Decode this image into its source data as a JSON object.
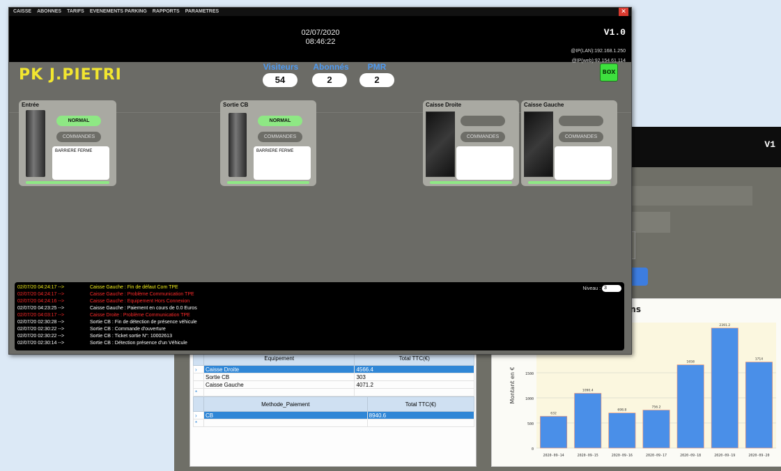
{
  "back_window": {
    "version": "V1",
    "table_equipment": {
      "headers": [
        "Equipement",
        "Total TTC(€)"
      ],
      "rows": [
        {
          "name": "Caisse Droite",
          "total": "4566.4",
          "selected": true
        },
        {
          "name": "Sortie CB",
          "total": "303",
          "selected": false
        },
        {
          "name": "Caisse Gauche",
          "total": "4071.2",
          "selected": false
        }
      ]
    },
    "table_payment": {
      "headers": [
        "Methode_Paiement",
        "Total TTC(€)"
      ],
      "rows": [
        {
          "name": "CB",
          "total": "8940.6",
          "selected": true
        }
      ]
    },
    "chart_title_visible": "actions"
  },
  "chart_data": {
    "type": "bar",
    "title": "actions",
    "ylabel": "Montant en €",
    "xlabel": "",
    "categories": [
      "2020-09-14",
      "2020-09-15",
      "2020-09-16",
      "2020-09-17",
      "2020-09-18",
      "2020-09-19",
      "2020-09-20"
    ],
    "values": [
      632,
      1090.4,
      698.8,
      756.2,
      1658,
      2391.2,
      1714
    ],
    "value_labels": [
      "632",
      "1090.4",
      "698.8",
      "756.2",
      "1658",
      "2391.2",
      "1714"
    ],
    "yticks": [
      0,
      500,
      1000,
      1500
    ],
    "ylim": [
      0,
      2500
    ],
    "grid": true,
    "bar_color": "#4a8fe8"
  },
  "front_window": {
    "menu": [
      "CAISSE",
      "ABONNES",
      "TARIFS",
      "EVENEMENTS PARKING",
      "RAPPORTS",
      "PARAMETRES"
    ],
    "date": "02/07/2020",
    "time": "08:46:22",
    "version": "V1.0",
    "ip_lan": "@IP(LAN):192.168.1.250",
    "ip_web": "@IP(web):92.154.61.114",
    "site_name": "PK J.PIETRI",
    "counters": [
      {
        "label": "Visiteurs",
        "value": "54"
      },
      {
        "label": "Abonnés",
        "value": "2"
      },
      {
        "label": "PMR",
        "value": "2"
      }
    ],
    "box_logo": "BOX",
    "equipment": [
      {
        "title": "Entrée",
        "status": "NORMAL",
        "commands": "COMMANDES",
        "info": "BARRIERE FERME"
      },
      {
        "title": "Sortie CB",
        "status": "NORMAL",
        "commands": "COMMANDES",
        "info": "BARRIERE FERME"
      },
      {
        "title": "Caisse Droite",
        "status": "",
        "commands": "COMMANDES",
        "info": ""
      },
      {
        "title": "Caisse Gauche",
        "status": "",
        "commands": "COMMANDES",
        "info": ""
      }
    ],
    "log": {
      "level_label": "Niveau :",
      "level_value": "3",
      "entries": [
        {
          "time": "02/07/20 04:24:17 -->",
          "msg": "Caisse Gauche : Fin de défaut Com TPE",
          "color": "#f4f01a"
        },
        {
          "time": "02/07/20 04:24:17 -->",
          "msg": "Caisse Gauche : Problème Communication TPE",
          "color": "#ff2a2a"
        },
        {
          "time": "02/07/20 04:24:16 -->",
          "msg": "Caisse Gauche : Equipement Hors Connexion",
          "color": "#ff2a2a"
        },
        {
          "time": "02/07/20 04:23:25 -->",
          "msg": "Caisse Gauche : Paiement en cours de 0.0 Euros",
          "color": "#ffffff"
        },
        {
          "time": "02/07/20 04:03:17 -->",
          "msg": "Caisse Droite : Problème Communication TPE",
          "color": "#ff2a2a"
        },
        {
          "time": "02/07/20 02:30:28 -->",
          "msg": "Sortie CB : Fin de détection de présence véhicule",
          "color": "#ffffff"
        },
        {
          "time": "02/07/20 02:30:22 -->",
          "msg": "Sortie CB : Commande d'ouverture",
          "color": "#ffffff"
        },
        {
          "time": "02/07/20 02:30:22 -->",
          "msg": "Sortie CB : Ticket sortie N°: 10002613",
          "color": "#ffffff"
        },
        {
          "time": "02/07/20 02:30:14 -->",
          "msg": "Sortie CB : Détection présence d'un Véhicule",
          "color": "#ffffff"
        }
      ]
    }
  }
}
